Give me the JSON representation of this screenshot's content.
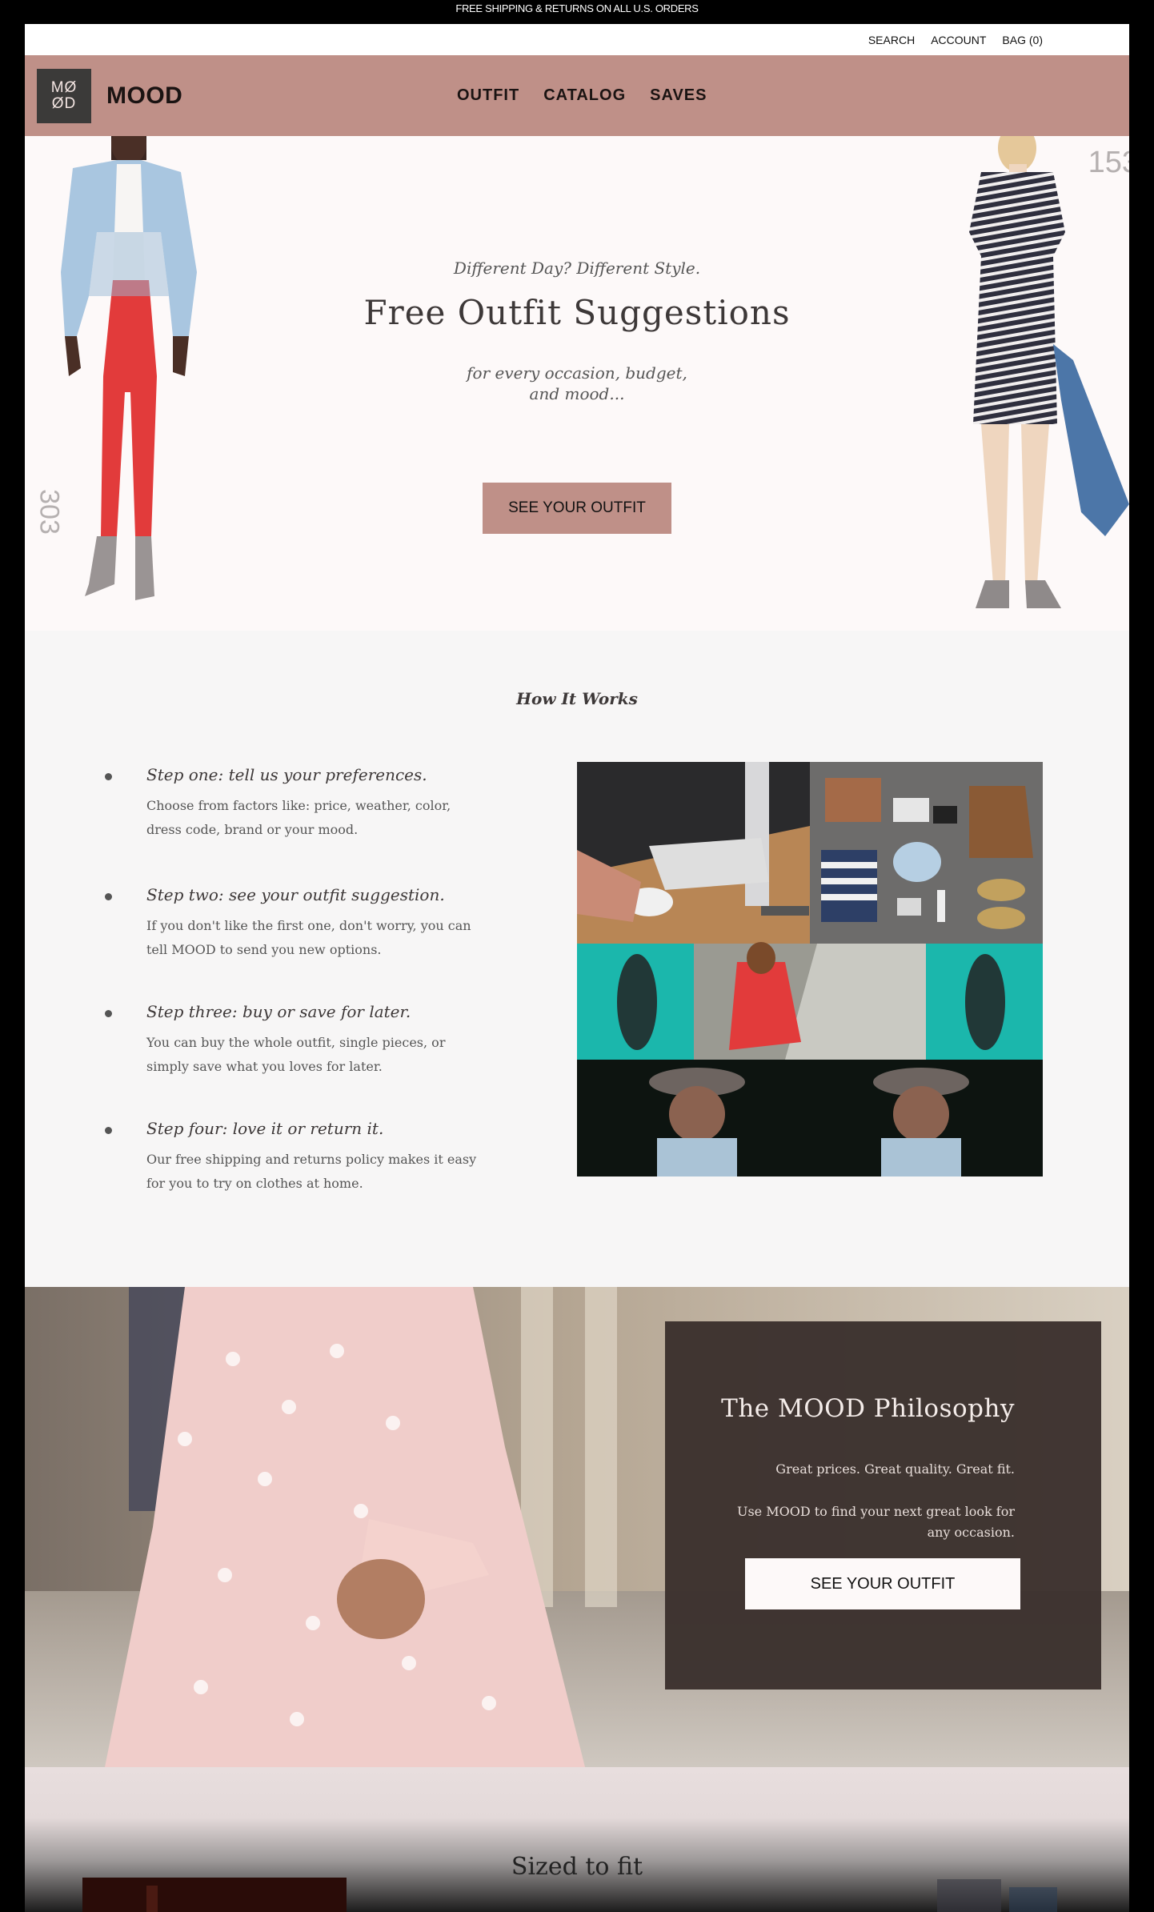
{
  "announcement": "FREE SHIPPING & RETURNS ON ALL U.S. ORDERS",
  "utility_links": {
    "search": "SEARCH",
    "account": "ACCOUNT",
    "bag": "BAG (0)"
  },
  "header": {
    "logo_line1": "MØ",
    "logo_line2": "ØD",
    "brand": "MOOD",
    "nav": {
      "outfit": "OUTFIT",
      "catalog": "CATALOG",
      "saves": "SAVES"
    }
  },
  "hero": {
    "tagline": "Different Day? Different Style.",
    "title": "Free Outfit Suggestions",
    "subtitle": "for every occasion, budget, and mood...",
    "cta": "SEE YOUR OUTFIT",
    "number_left": "303",
    "number_right": "153"
  },
  "how_it_works": {
    "heading": "How It Works",
    "steps": [
      {
        "title": "Step one: tell us your preferences.",
        "desc": "Choose from factors like: price, weather, color, dress code, brand or your mood."
      },
      {
        "title": "Step two: see your outfit suggestion.",
        "desc": "If you don't like the first one, don't worry, you can tell MOOD to send you new options."
      },
      {
        "title": "Step three: buy or save for later.",
        "desc": "You can buy the whole outfit, single pieces, or simply save what you loves for later."
      },
      {
        "title": "Step four: love it or return it.",
        "desc": "Our free shipping and returns policy makes it easy for you to try on clothes at home."
      }
    ]
  },
  "philosophy": {
    "title": "The MOOD Philosophy",
    "line1": "Great prices. Great quality. Great fit.",
    "line2": "Use MOOD to find your next great look for any occasion.",
    "cta": "SEE YOUR OUTFIT"
  },
  "sized": {
    "title": "Sized to fit"
  },
  "colors": {
    "accent": "#bf9088",
    "dark_box": "#3a302d",
    "hero_bg": "#fdf9f9",
    "section_bg": "#f7f6f6"
  }
}
